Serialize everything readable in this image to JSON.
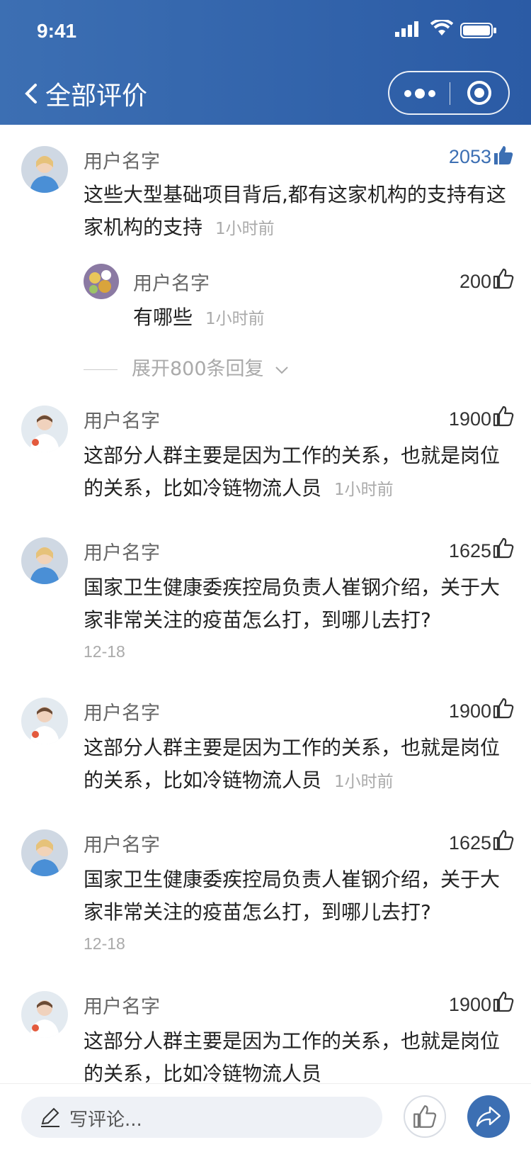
{
  "status": {
    "time": "9:41"
  },
  "nav": {
    "title": "全部评价"
  },
  "comments": [
    {
      "user": "用户名字",
      "likes": "2053",
      "liked": true,
      "text": "这些大型基础项目背后,都有这家机构的支持有这家机构的支持",
      "time": "1小时前",
      "reply": {
        "user": "用户名字",
        "likes": "200",
        "text": "有哪些",
        "time": "1小时前"
      },
      "expand": "展开800条回复"
    },
    {
      "user": "用户名字",
      "likes": "1900",
      "text": "这部分人群主要是因为工作的关系，也就是岗位的关系，比如冷链物流人员",
      "time": "1小时前"
    },
    {
      "user": "用户名字",
      "likes": "1625",
      "text": "国家卫生健康委疾控局负责人崔钢介绍，关于大家非常关注的疫苗怎么打，到哪儿去打?",
      "date": "12-18"
    },
    {
      "user": "用户名字",
      "likes": "1900",
      "text": "这部分人群主要是因为工作的关系，也就是岗位的关系，比如冷链物流人员",
      "time": "1小时前"
    },
    {
      "user": "用户名字",
      "likes": "1625",
      "text": "国家卫生健康委疾控局负责人崔钢介绍，关于大家非常关注的疫苗怎么打，到哪儿去打?",
      "date": "12-18"
    },
    {
      "user": "用户名字",
      "likes": "1900",
      "text": "这部分人群主要是因为工作的关系，也就是岗位的关系，比如冷链物流人员",
      "time": ""
    }
  ],
  "bottom": {
    "placeholder": "写评论..."
  },
  "colors": {
    "brand": "#3c6fb3",
    "muted": "#aaaaaa"
  }
}
